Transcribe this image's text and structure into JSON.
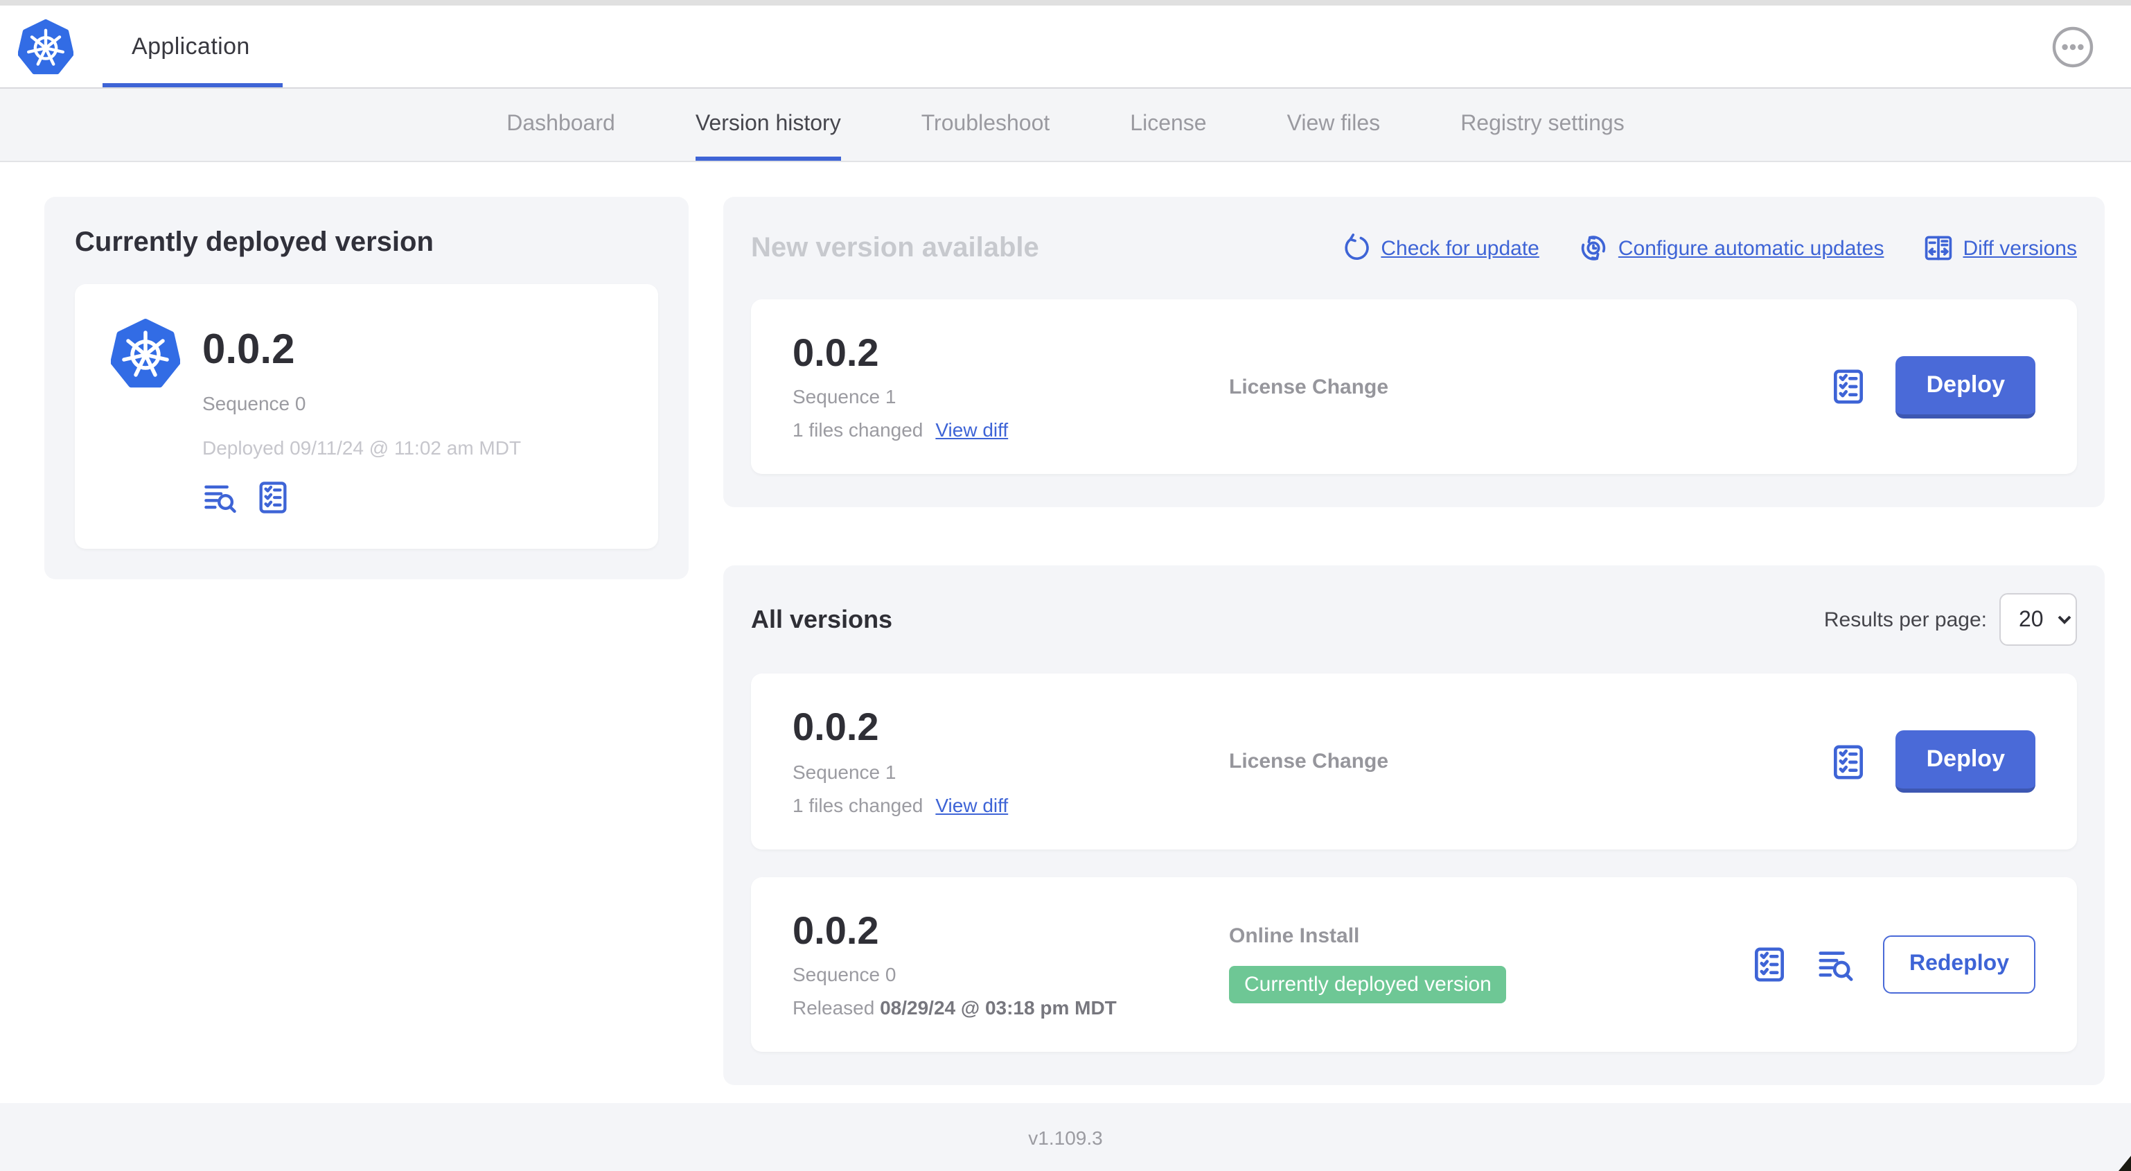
{
  "header": {
    "app_title": "Application"
  },
  "nav": {
    "tabs": [
      {
        "label": "Dashboard",
        "active": false
      },
      {
        "label": "Version history",
        "active": true
      },
      {
        "label": "Troubleshoot",
        "active": false
      },
      {
        "label": "License",
        "active": false
      },
      {
        "label": "View files",
        "active": false
      },
      {
        "label": "Registry settings",
        "active": false
      }
    ]
  },
  "current_version_card": {
    "title": "Currently deployed version",
    "version": "0.0.2",
    "sequence": "Sequence 0",
    "deployed": "Deployed 09/11/24 @ 11:02 am MDT",
    "icons": [
      "logs-icon",
      "preflight-checks-icon"
    ]
  },
  "new_version_section": {
    "title": "New version available",
    "actions": [
      {
        "label": "Check for update",
        "icon": "refresh-icon"
      },
      {
        "label": "Configure automatic updates",
        "icon": "auto-update-icon"
      },
      {
        "label": "Diff versions",
        "icon": "diff-icon"
      }
    ],
    "row": {
      "version": "0.0.2",
      "sequence": "Sequence 1",
      "files_changed": "1 files changed",
      "view_diff_label": "View diff",
      "source": "License Change",
      "deploy_label": "Deploy"
    }
  },
  "all_versions_section": {
    "title": "All versions",
    "results_per_page_label": "Results per page:",
    "results_per_page_value": "20",
    "rows": [
      {
        "version": "0.0.2",
        "sequence": "Sequence 1",
        "files_changed": "1 files changed",
        "view_diff_label": "View diff",
        "source": "License Change",
        "action_label": "Deploy"
      },
      {
        "version": "0.0.2",
        "sequence": "Sequence 0",
        "released_prefix": "Released",
        "released_date": "08/29/24 @ 03:18 pm MDT",
        "source": "Online Install",
        "badge": "Currently deployed version",
        "action_label": "Redeploy"
      }
    ]
  },
  "footer": {
    "version": "v1.109.3"
  },
  "colors": {
    "link_blue": "#3E64D6",
    "button_blue": "#4A6AD8",
    "badge_green": "#6EC795",
    "kube_blue": "#326CE5",
    "section_bg": "#F4F5F8"
  }
}
